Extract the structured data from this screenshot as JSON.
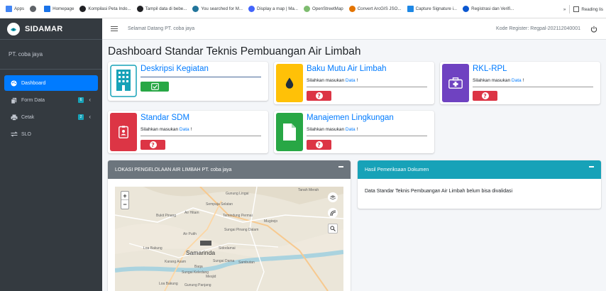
{
  "bookmarks": {
    "items": [
      {
        "label": "Apps",
        "icon": "apps-grid-icon",
        "color": "#4285f4"
      },
      {
        "label": "",
        "icon": "chrome-icon",
        "color": "#5f6368"
      },
      {
        "label": "Homepage",
        "icon": "homepage-icon",
        "color": "#1a73e8"
      },
      {
        "label": "Kompilasi Peta Indo...",
        "icon": "circle-dark-icon",
        "color": "#202124"
      },
      {
        "label": "Tampil data di bebe...",
        "icon": "circle-dark-icon",
        "color": "#202124"
      },
      {
        "label": "You searched for M...",
        "icon": "wordpress-icon",
        "color": "#21759b"
      },
      {
        "label": "Display a map | Ma...",
        "icon": "mapbox-icon",
        "color": "#4264fb"
      },
      {
        "label": "OpenStreetMap",
        "icon": "osm-icon",
        "color": "#7ebc6f"
      },
      {
        "label": "Convert ArcGIS JSO...",
        "icon": "map-pin-icon",
        "color": "#e37400"
      },
      {
        "label": "Capture Signature i...",
        "icon": "capture-icon",
        "color": "#1e88e5"
      },
      {
        "label": "Registrasi dan Verifi...",
        "icon": "circle-blue-icon",
        "color": "#0b57d0"
      }
    ],
    "overflow": "»",
    "reading_list": "Reading lis"
  },
  "sidebar": {
    "brand": "SIDAMAR",
    "user": "PT. coba jaya",
    "items": [
      {
        "label": "Dashboard",
        "icon": "palette-icon",
        "active": true
      },
      {
        "label": "Form Data",
        "icon": "copy-icon",
        "badge": "6",
        "badge_color": "#17a2b8"
      },
      {
        "label": "Cetak",
        "icon": "print-icon",
        "badge": "2",
        "badge_color": "#17a2b8"
      },
      {
        "label": "SLO",
        "icon": "exchange-icon"
      }
    ]
  },
  "topbar": {
    "welcome": "Selamat Datang PT. coba jaya",
    "register": "Kode Register: Regpal-202112040001"
  },
  "page": {
    "title": "Dashboard Standar Teknis Pembuangan Air Limbah"
  },
  "info_cards": [
    {
      "title": "Deskripsi Kegiatan",
      "subtitle": "",
      "status": "done",
      "icon": "building-icon",
      "color": "#17a2b8"
    },
    {
      "title": "Baku Mutu Air Limbah",
      "subtitle": "Silahkan masukan ",
      "link": "Data",
      "suffix": " !",
      "status": "missing",
      "icon": "tint-icon",
      "color": "#ffc107"
    },
    {
      "title": "RKL-RPL",
      "subtitle": "Silahkan masukan ",
      "link": "Data",
      "suffix": " !",
      "status": "missing",
      "icon": "medkit-icon",
      "color": "#6f42c1"
    },
    {
      "title": "Standar SDM",
      "subtitle": "Silahkan masukan ",
      "link": "Data",
      "suffix": " !",
      "status": "missing",
      "icon": "id-badge-icon",
      "color": "#dc3545"
    },
    {
      "title": "Manajemen Lingkungan",
      "subtitle": "Silahkan masukan ",
      "link": "Data",
      "suffix": " !",
      "status": "missing",
      "icon": "file-icon",
      "color": "#28a745"
    }
  ],
  "map_panel": {
    "title": "LOKASI PENGELOLAAN AIR LIMBAH PT. coba jaya",
    "header_color": "#6c757d",
    "zoom_in": "+",
    "zoom_out": "−",
    "labels": [
      "Tanah Merah",
      "Gunung Lingai",
      "Sempaja Selatan",
      "Bukit Pinang",
      "Air Hitam",
      "Temindung Permai",
      "Mugirejo",
      "Sungai Pinang Dalam",
      "Air Putih",
      "Samarinda",
      "Sidodamai",
      "Loa Bakung",
      "Karang Asam",
      "Sungai Dama",
      "Sambutan",
      "Sungai Keledang",
      "Mesjid",
      "Baqa",
      "Gunung Panjang",
      "Loa Bakung"
    ]
  },
  "hasil_panel": {
    "title": "Hasil Pemeriksaan Dokumen",
    "header_color": "#17a2b8",
    "message": "Data Standar Teknis Pembuangan Air Limbah belum bisa divalidasi"
  }
}
